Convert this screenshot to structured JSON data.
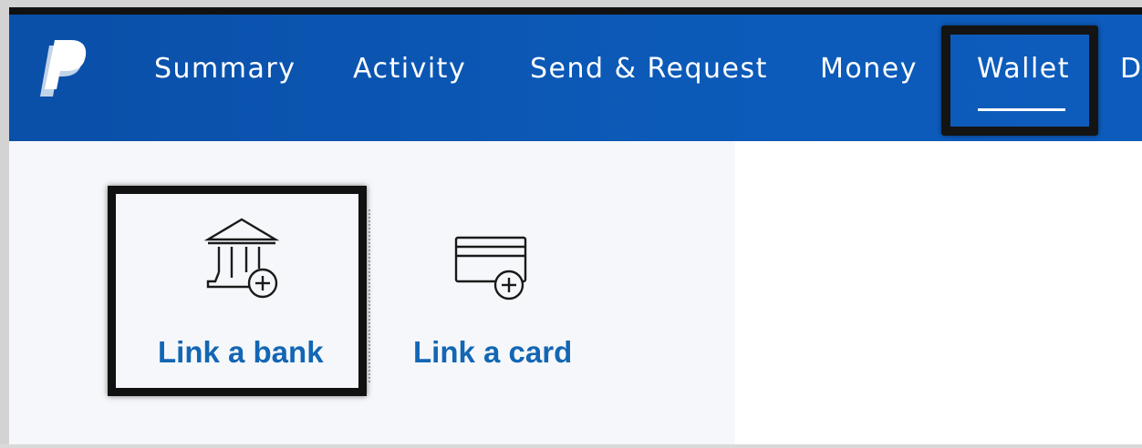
{
  "nav": {
    "items": [
      {
        "label": "Summary"
      },
      {
        "label": "Activity"
      },
      {
        "label": "Send & Request"
      },
      {
        "label": "Money"
      },
      {
        "label": "Wallet"
      },
      {
        "label": "D"
      }
    ],
    "active": "Wallet"
  },
  "wallet": {
    "options": [
      {
        "label": "Link a bank",
        "icon": "bank-add-icon"
      },
      {
        "label": "Link a card",
        "icon": "card-add-icon"
      }
    ]
  },
  "colors": {
    "nav_bg": "#0c55b3",
    "link_text": "#1366b3",
    "panel_bg": "#f5f7fa",
    "highlight_border": "#111111"
  }
}
